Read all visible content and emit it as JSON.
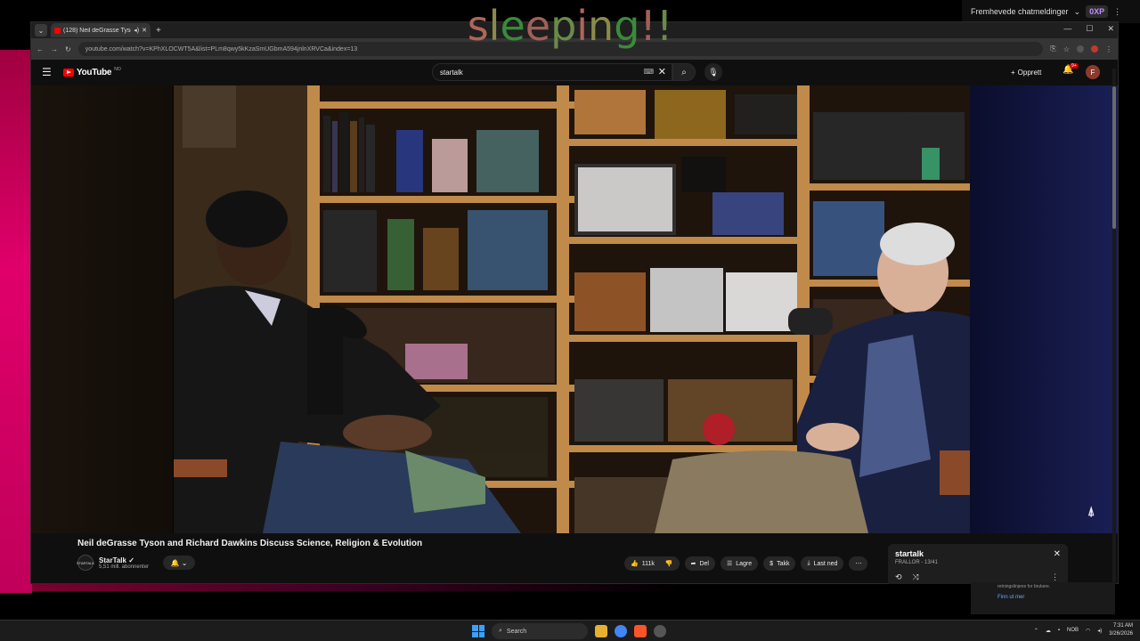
{
  "overlay": {
    "sleeping_text": "sleeping!!",
    "chat_label": "Fremhevede chatmeldinger",
    "xp_label": "0XP"
  },
  "browser": {
    "tab_title": "(128) Neil deGrasse Tyson a",
    "url": "youtube.com/watch?v=KPhXLOCWT5A&list=PLm8qwy5kKzaSmUGbmA594jnlnXRVCa&index=13"
  },
  "youtube": {
    "logo_text": "YouTube",
    "logo_country": "NO",
    "search_value": "startalk",
    "create_label": "Opprett",
    "notif_badge": "9+",
    "avatar_letter": "F",
    "video_title": "Neil deGrasse Tyson and Richard Dawkins Discuss Science, Religion & Evolution",
    "channel_name": "StarTalk",
    "channel_avatar": "STARTALK",
    "subscribers": "5,51 mill. abonnenter",
    "actions": {
      "likes": "111k",
      "share": "Del",
      "save": "Lagre",
      "thanks": "Takk",
      "download": "Last ned"
    },
    "playlist": {
      "title": "startalk",
      "subtitle": "FRALLOR - 13/41"
    },
    "side_notice": {
      "text": "retningslinjene for brukere.",
      "link": "Finn ut mer"
    }
  },
  "taskbar": {
    "search_label": "Search",
    "lang": "NOB",
    "time": "7:31 AM",
    "date": "3/26/2026"
  }
}
